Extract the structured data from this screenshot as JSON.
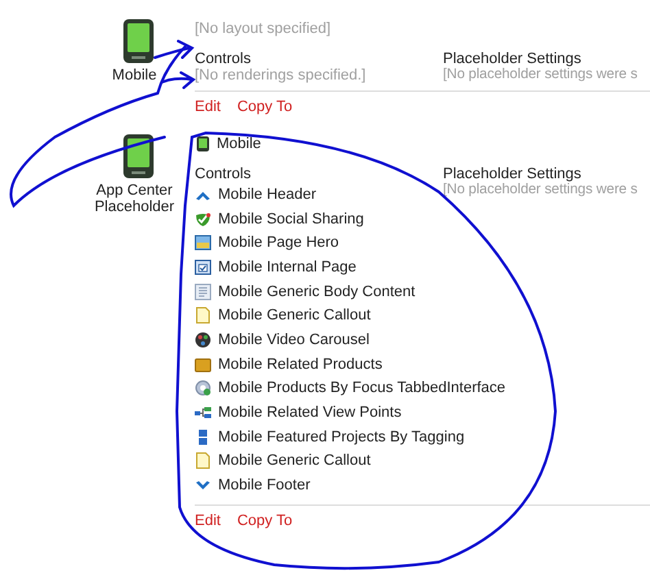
{
  "sections": [
    {
      "device": {
        "label": "Mobile"
      },
      "layout": {
        "text": "[No layout specified]",
        "kind": "empty"
      },
      "controls": {
        "heading": "Controls",
        "empty_text": "[No renderings specified.]"
      },
      "placeholder_settings": {
        "heading": "Placeholder Settings",
        "text": "[No placeholder settings were s"
      },
      "actions": [
        "Edit",
        "Copy To"
      ]
    },
    {
      "device": {
        "label": "App Center Placeholder"
      },
      "layout": {
        "text": "Mobile",
        "kind": "device"
      },
      "controls": {
        "heading": "Controls",
        "items": [
          {
            "label": "Mobile Header",
            "kind": "header"
          },
          {
            "label": "Mobile Social Sharing",
            "kind": "social"
          },
          {
            "label": "Mobile Page Hero",
            "kind": "hero"
          },
          {
            "label": "Mobile Internal Page",
            "kind": "page"
          },
          {
            "label": "Mobile Generic Body Content",
            "kind": "content"
          },
          {
            "label": "Mobile Generic Callout",
            "kind": "callout"
          },
          {
            "label": "Mobile Video Carousel",
            "kind": "video"
          },
          {
            "label": "Mobile Related Products",
            "kind": "products"
          },
          {
            "label": "Mobile Products By Focus TabbedInterface",
            "kind": "focus"
          },
          {
            "label": "Mobile Related View Points",
            "kind": "viewpoints"
          },
          {
            "label": "Mobile Featured Projects By Tagging",
            "kind": "featured"
          },
          {
            "label": "Mobile Generic Callout",
            "kind": "callout"
          },
          {
            "label": "Mobile Footer",
            "kind": "footer"
          }
        ]
      },
      "placeholder_settings": {
        "heading": "Placeholder Settings",
        "text": "[No placeholder settings were s"
      },
      "actions": [
        "Edit",
        "Copy To"
      ]
    }
  ]
}
